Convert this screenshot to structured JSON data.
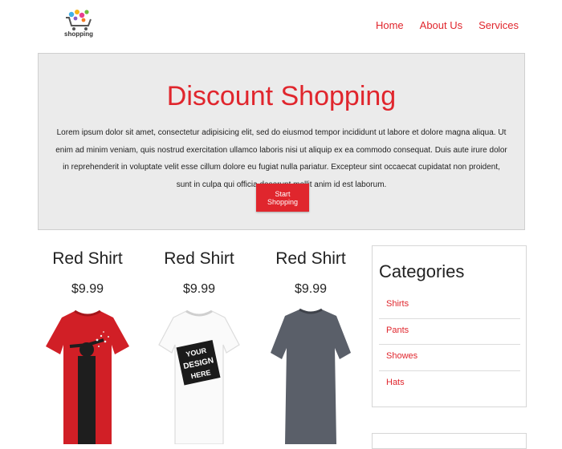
{
  "header": {
    "logo_text": "shopping",
    "nav": [
      "Home",
      "About Us",
      "Services"
    ]
  },
  "hero": {
    "title": "Discount Shopping",
    "body": "Lorem ipsum dolor sit amet, consectetur adipisicing elit, sed do eiusmod tempor incididunt ut labore et dolore magna aliqua. Ut enim ad minim veniam, quis nostrud exercitation ullamco laboris nisi ut aliquip ex ea commodo consequat. Duis aute irure dolor in reprehenderit in voluptate velit esse cillum dolore eu fugiat nulla pariatur. Excepteur sint occaecat cupidatat non proident, sunt in culpa qui officia deserunt mollit anim id est laborum.",
    "button": "Start Shopping"
  },
  "products": [
    {
      "name": "Red Shirt",
      "price": "$9.99",
      "image": "red-tshirt"
    },
    {
      "name": "Red Shirt",
      "price": "$9.99",
      "image": "white-tshirt"
    },
    {
      "name": "Red Shirt",
      "price": "$9.99",
      "image": "gray-tshirt"
    }
  ],
  "sidebar": {
    "title": "Categories",
    "items": [
      "Shirts",
      "Pants",
      "Showes",
      "Hats"
    ]
  },
  "colors": {
    "accent": "#e0262d",
    "hero_bg": "#ebebeb"
  }
}
